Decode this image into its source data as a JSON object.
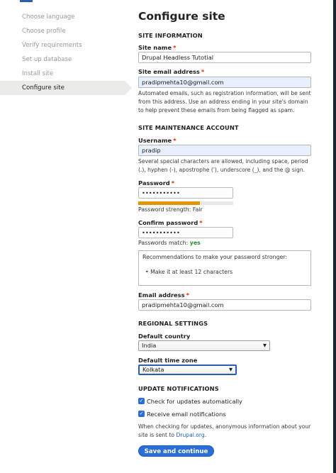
{
  "sidebar": {
    "items": [
      {
        "label": "Choose language"
      },
      {
        "label": "Choose profile"
      },
      {
        "label": "Verify requirements"
      },
      {
        "label": "Set up database"
      },
      {
        "label": "Install site"
      },
      {
        "label": "Configure site"
      }
    ]
  },
  "page": {
    "title": "Configure site"
  },
  "site_info": {
    "section_title": "SITE INFORMATION",
    "site_name_label": "Site name",
    "site_name_value": "Drupal Headless Tutotial",
    "site_email_label": "Site email address",
    "site_email_value": "pradipmehta10@gmail.com",
    "site_email_desc": "Automated emails, such as registration information, will be sent from this address. Use an address ending in your site's domain to help prevent these emails from being flagged as spam."
  },
  "maintenance": {
    "section_title": "SITE MAINTENANCE ACCOUNT",
    "username_label": "Username",
    "username_value": "pradip",
    "username_desc": "Several special characters are allowed, including space, period (.), hyphen (-), apostrophe ('), underscore (_), and the @ sign.",
    "password_label": "Password",
    "password_value": "•••••••••••",
    "strength_level": 0.65,
    "strength_prefix": "Password strength:",
    "strength_value": "Fair",
    "confirm_label": "Confirm password",
    "confirm_value": "•••••••••••",
    "match_prefix": "Passwords match:",
    "match_value": "yes",
    "recommend_title": "Recommendations to make your password stronger:",
    "recommend_items": [
      "Make it at least 12 characters"
    ],
    "email_label": "Email address",
    "email_value": "pradipmehta10@gmail.com"
  },
  "regional": {
    "section_title": "REGIONAL SETTINGS",
    "country_label": "Default country",
    "country_value": "India",
    "timezone_label": "Default time zone",
    "timezone_value": "Kolkata"
  },
  "updates": {
    "section_title": "UPDATE NOTIFICATIONS",
    "check_updates_label": "Check for updates automatically",
    "email_notify_label": "Receive email notifications",
    "desc_prefix": "When checking for updates, anonymous information about your site is sent to",
    "desc_link": "Drupal.org",
    "desc_suffix": "."
  },
  "actions": {
    "submit_label": "Save and continue"
  },
  "icons": {
    "checkbox": "checkmark-icon",
    "select_arrow": "chevron-down-icon",
    "required": "asterisk-icon"
  },
  "colors": {
    "accent": "#2b6fd6",
    "required": "#e32700",
    "strength": "#e09600",
    "match": "#2f8a2f"
  }
}
